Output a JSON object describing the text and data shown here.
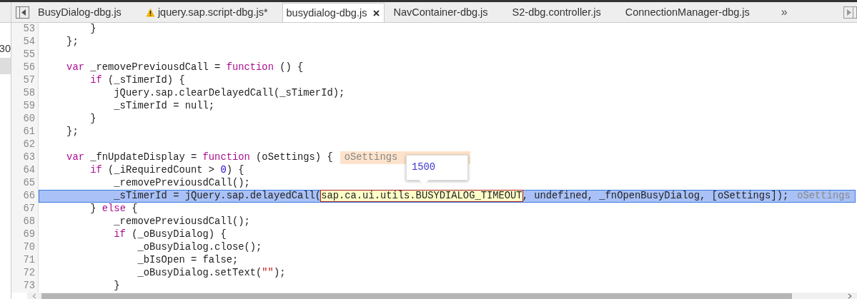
{
  "left_panel": {
    "text": "30"
  },
  "tabs": [
    {
      "label": "BusyDialog-dbg.js",
      "selected": false,
      "warning": false
    },
    {
      "label": "jquery.sap.script-dbg.js*",
      "selected": false,
      "warning": true
    },
    {
      "label": "busydialog-dbg.js",
      "selected": true,
      "warning": false
    },
    {
      "label": "NavContainer-dbg.js",
      "selected": false,
      "warning": false
    },
    {
      "label": "S2-dbg.controller.js",
      "selected": false,
      "warning": false
    },
    {
      "label": "ConnectionManager-dbg.js",
      "selected": false,
      "warning": false
    }
  ],
  "tabs_overflow": "»",
  "code_lines": [
    {
      "number": "53",
      "highlighted": false,
      "tokens": [
        {
          "kind": "plain",
          "text": "        }"
        }
      ]
    },
    {
      "number": "54",
      "highlighted": false,
      "tokens": [
        {
          "kind": "plain",
          "text": "    };"
        }
      ]
    },
    {
      "number": "55",
      "highlighted": false
    },
    {
      "number": "56",
      "highlighted": false,
      "tokens": [
        {
          "kind": "keyword",
          "text": "    var"
        },
        {
          "kind": "plain",
          "text": " _removePreviousdCall = "
        },
        {
          "kind": "keyword",
          "text": "function"
        },
        {
          "kind": "plain",
          "text": " () {"
        }
      ]
    },
    {
      "number": "57",
      "highlighted": false,
      "tokens": [
        {
          "kind": "keyword",
          "text": "        if"
        },
        {
          "kind": "plain",
          "text": " (_sTimerId) {"
        }
      ]
    },
    {
      "number": "58",
      "highlighted": false,
      "tokens": [
        {
          "kind": "plain",
          "text": "            jQuery.sap.clearDelayedCall(_sTimerId);"
        }
      ]
    },
    {
      "number": "59",
      "highlighted": false,
      "tokens": [
        {
          "kind": "plain",
          "text": "            _sTimerId = null;"
        }
      ]
    },
    {
      "number": "60",
      "highlighted": false,
      "tokens": [
        {
          "kind": "plain",
          "text": "        }"
        }
      ]
    },
    {
      "number": "61",
      "highlighted": false,
      "tokens": [
        {
          "kind": "plain",
          "text": "    };"
        }
      ]
    },
    {
      "number": "62",
      "highlighted": false
    },
    {
      "number": "63",
      "highlighted": false,
      "tokens": [
        {
          "kind": "keyword",
          "text": "    var"
        },
        {
          "kind": "plain",
          "text": " _fnUpdateDisplay = "
        },
        {
          "kind": "keyword",
          "text": "function"
        },
        {
          "kind": "plain",
          "text": " (oSettings) {"
        }
      ],
      "hint": "oSettings"
    },
    {
      "number": "64",
      "highlighted": false,
      "tokens": [
        {
          "kind": "keyword",
          "text": "        if"
        },
        {
          "kind": "plain",
          "text": " (_iRequiredCount > "
        },
        {
          "kind": "number",
          "text": "0"
        },
        {
          "kind": "plain",
          "text": ") {"
        }
      ]
    },
    {
      "number": "65",
      "highlighted": false,
      "tokens": [
        {
          "kind": "plain",
          "text": "            _removePreviousdCall();"
        }
      ]
    },
    {
      "number": "66",
      "highlighted": true,
      "tokens": [
        {
          "kind": "plain",
          "text": "            _sTimerId = jQuery.sap.delayedCall("
        },
        {
          "kind": "inspected",
          "text": "sap.ca.ui.utils.BUSYDIALOG_TIMEOUT"
        },
        {
          "kind": "plain",
          "text": ", undefined, _fnOpenBusyDialog, [oSettings]);"
        }
      ],
      "hint": "oSettings",
      "tooltip": "1500"
    },
    {
      "number": "67",
      "highlighted": false,
      "tokens": [
        {
          "kind": "plain",
          "text": "        } "
        },
        {
          "kind": "keyword",
          "text": "else"
        },
        {
          "kind": "plain",
          "text": " {"
        }
      ]
    },
    {
      "number": "68",
      "highlighted": false,
      "tokens": [
        {
          "kind": "plain",
          "text": "            _removePreviousdCall();"
        }
      ]
    },
    {
      "number": "69",
      "highlighted": false,
      "tokens": [
        {
          "kind": "keyword",
          "text": "            if"
        },
        {
          "kind": "plain",
          "text": " (_oBusyDialog) {"
        }
      ]
    },
    {
      "number": "70",
      "highlighted": false,
      "tokens": [
        {
          "kind": "plain",
          "text": "                _oBusyDialog.close();"
        }
      ]
    },
    {
      "number": "71",
      "highlighted": false,
      "tokens": [
        {
          "kind": "plain",
          "text": "                _bIsOpen = false;"
        }
      ]
    },
    {
      "number": "72",
      "highlighted": false,
      "tokens": [
        {
          "kind": "plain",
          "text": "                _oBusyDialog.setText("
        },
        {
          "kind": "string",
          "text": "\"\""
        },
        {
          "kind": "plain",
          "text": ");"
        }
      ]
    },
    {
      "number": "73",
      "highlighted": false,
      "tokens": [
        {
          "kind": "plain",
          "text": "            }"
        }
      ]
    }
  ]
}
